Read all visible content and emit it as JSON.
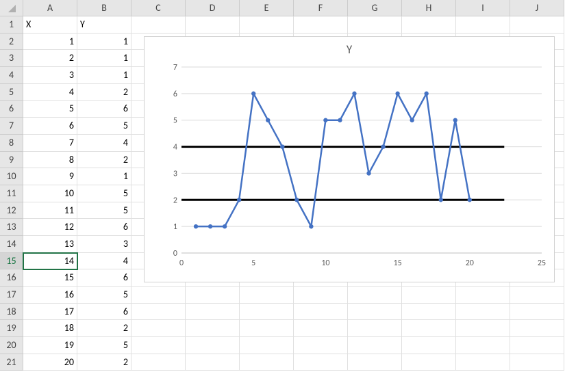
{
  "columns": [
    "A",
    "B",
    "C",
    "D",
    "E",
    "F",
    "G",
    "H",
    "I",
    "J"
  ],
  "row_count": 21,
  "active_row": 15,
  "headers": {
    "A": "X",
    "B": "Y"
  },
  "table": {
    "rows": [
      {
        "x": 1,
        "y": 1
      },
      {
        "x": 2,
        "y": 1
      },
      {
        "x": 3,
        "y": 1
      },
      {
        "x": 4,
        "y": 2
      },
      {
        "x": 5,
        "y": 6
      },
      {
        "x": 6,
        "y": 5
      },
      {
        "x": 7,
        "y": 4
      },
      {
        "x": 8,
        "y": 2
      },
      {
        "x": 9,
        "y": 1
      },
      {
        "x": 10,
        "y": 5
      },
      {
        "x": 11,
        "y": 5
      },
      {
        "x": 12,
        "y": 6
      },
      {
        "x": 13,
        "y": 3
      },
      {
        "x": 14,
        "y": 4
      },
      {
        "x": 15,
        "y": 6
      },
      {
        "x": 16,
        "y": 5
      },
      {
        "x": 17,
        "y": 6
      },
      {
        "x": 18,
        "y": 2
      },
      {
        "x": 19,
        "y": 5
      },
      {
        "x": 20,
        "y": 2
      }
    ]
  },
  "chart_data": {
    "type": "line",
    "title": "Y",
    "x": [
      1,
      2,
      3,
      4,
      5,
      6,
      7,
      8,
      9,
      10,
      11,
      12,
      13,
      14,
      15,
      16,
      17,
      18,
      19,
      20
    ],
    "values": [
      1,
      1,
      1,
      2,
      6,
      5,
      4,
      2,
      1,
      5,
      5,
      6,
      3,
      4,
      6,
      5,
      6,
      2,
      5,
      2
    ],
    "xlim": [
      0,
      25
    ],
    "ylim": [
      0,
      7
    ],
    "yticks": [
      0,
      1,
      2,
      3,
      4,
      5,
      6,
      7
    ],
    "xticks": [
      0,
      5,
      10,
      15,
      20,
      25
    ],
    "reference_lines": [
      {
        "y": 2,
        "xmin": 0,
        "xmax": 22.4
      },
      {
        "y": 4,
        "xmin": 0,
        "xmax": 22.4
      }
    ]
  }
}
